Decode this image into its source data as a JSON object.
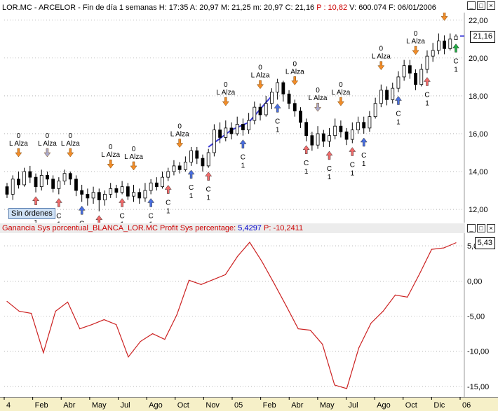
{
  "colors": {
    "background": "#ffffff",
    "header_bg": "#e8e8e8",
    "price_header_text": "#000000",
    "indicator_header_text": "#cc0000",
    "p_value_color": "#cc0000",
    "candle_up": "#ffffff",
    "candle_down": "#000000",
    "trend_line": "#3b3bd8",
    "equity_line": "#cc2222",
    "grid": "#888888",
    "arrow_short": "#f28c28",
    "arrow_long": "#f26a6a",
    "arrow_close_long": "#4a6fe0",
    "arrow_close_short": "#aaaacc",
    "arrow_green": "#22aa44",
    "axis_bg": "#f6f0c8",
    "order_box_bg": "#cfe1f5"
  },
  "price_panel": {
    "header": {
      "symbol": "LOR.MC - ARCELOR - Fin de día 1 semanas",
      "high": "H: 17:35",
      "open": "A: 20,97",
      "max": "M: 21,25",
      "min": "m: 20,97",
      "close": "C: 21,16",
      "p_value": "P : 10,82",
      "volume": "V: 600.074",
      "date": "F: 06/01/2006"
    },
    "last_value": "21,16",
    "order_label": "Sin órdenes",
    "window_buttons": [
      "_",
      "□",
      "×"
    ]
  },
  "indicator_panel": {
    "header": {
      "title": "Ganancia Sys porcentual_BLANCA_LOR.MC  Profit Sys percentage:",
      "value": "5,4297",
      "p_label": "P: -10,2411"
    },
    "last_value": "5,43",
    "window_buttons": [
      "_",
      "□",
      "×"
    ]
  },
  "x_axis": {
    "labels": [
      "4",
      "Feb",
      "Abr",
      "May",
      "Jul",
      "Ago",
      "Oct",
      "Nov",
      "05",
      "Feb",
      "Abr",
      "May",
      "Jul",
      "Ago",
      "Oct",
      "Dic",
      "06"
    ]
  },
  "signal_text": {
    "zero": "0",
    "short_label": "L Alza",
    "close_label": "C",
    "one": "1"
  },
  "chart_data": [
    {
      "type": "candlestick",
      "title": "",
      "ylim": [
        11.3,
        22.4
      ],
      "y_ticks": [
        "12,00",
        "14,00",
        "16,00",
        "18,00",
        "20,00",
        "22,00"
      ],
      "y_tick_values": [
        12,
        14,
        16,
        18,
        20,
        22
      ],
      "grid": true,
      "candles": [
        [
          13.2,
          12.8,
          13.4,
          12.6
        ],
        [
          12.8,
          13.6,
          13.8,
          12.5
        ],
        [
          13.6,
          13.3,
          14.0,
          13.1
        ],
        [
          13.3,
          14.0,
          14.2,
          13.2
        ],
        [
          14.0,
          13.7,
          14.3,
          13.4
        ],
        [
          13.7,
          13.2,
          13.9,
          12.9
        ],
        [
          13.2,
          13.8,
          14.1,
          13.0
        ],
        [
          13.8,
          13.6,
          14.0,
          13.3
        ],
        [
          13.6,
          13.1,
          13.8,
          12.9
        ],
        [
          13.1,
          13.5,
          13.7,
          12.8
        ],
        [
          13.5,
          13.9,
          14.1,
          13.3
        ],
        [
          13.9,
          13.6,
          14.0,
          13.3
        ],
        [
          13.6,
          13.0,
          13.8,
          12.7
        ],
        [
          13.0,
          12.8,
          13.3,
          12.4
        ],
        [
          12.8,
          12.6,
          13.1,
          12.2
        ],
        [
          12.6,
          12.9,
          13.2,
          12.3
        ],
        [
          12.9,
          12.5,
          13.1,
          11.9
        ],
        [
          12.5,
          12.8,
          13.0,
          12.2
        ],
        [
          12.8,
          13.1,
          13.4,
          12.6
        ],
        [
          13.1,
          12.9,
          13.3,
          12.6
        ],
        [
          12.9,
          13.2,
          13.5,
          12.8
        ],
        [
          13.2,
          12.7,
          13.4,
          12.5
        ],
        [
          12.7,
          12.9,
          13.3,
          12.4
        ],
        [
          12.9,
          12.6,
          13.1,
          12.3
        ],
        [
          12.6,
          13.0,
          13.4,
          12.4
        ],
        [
          13.0,
          13.4,
          13.6,
          12.8
        ],
        [
          13.4,
          13.2,
          13.7,
          13.0
        ],
        [
          13.2,
          13.7,
          14.0,
          13.1
        ],
        [
          13.7,
          14.0,
          14.2,
          13.5
        ],
        [
          14.0,
          14.3,
          14.6,
          13.8
        ],
        [
          14.3,
          14.1,
          14.5,
          13.9
        ],
        [
          14.1,
          14.5,
          14.8,
          14.0
        ],
        [
          14.5,
          15.1,
          15.3,
          14.3
        ],
        [
          15.1,
          14.7,
          15.3,
          14.4
        ],
        [
          14.7,
          14.3,
          14.9,
          14.0
        ],
        [
          14.3,
          15.0,
          15.2,
          14.2
        ],
        [
          15.0,
          16.2,
          16.5,
          14.8
        ],
        [
          16.2,
          15.8,
          16.6,
          15.5
        ],
        [
          15.8,
          16.3,
          16.7,
          15.6
        ],
        [
          16.3,
          16.0,
          16.6,
          15.7
        ],
        [
          16.0,
          16.5,
          16.9,
          15.9
        ],
        [
          16.5,
          16.2,
          16.8,
          15.9
        ],
        [
          16.2,
          16.7,
          17.1,
          16.0
        ],
        [
          16.7,
          17.4,
          17.7,
          16.5
        ],
        [
          17.4,
          17.0,
          17.6,
          16.7
        ],
        [
          17.0,
          17.6,
          18.0,
          16.9
        ],
        [
          17.6,
          18.2,
          18.4,
          17.3
        ],
        [
          18.2,
          18.7,
          18.9,
          17.8
        ],
        [
          18.7,
          18.1,
          18.8,
          17.7
        ],
        [
          18.1,
          17.6,
          18.3,
          17.3
        ],
        [
          17.6,
          17.2,
          17.8,
          16.9
        ],
        [
          17.2,
          16.6,
          17.4,
          16.3
        ],
        [
          16.6,
          15.9,
          16.8,
          15.6
        ],
        [
          15.9,
          15.4,
          16.1,
          15.1
        ],
        [
          15.4,
          16.0,
          16.4,
          15.2
        ],
        [
          16.0,
          15.6,
          16.2,
          15.3
        ],
        [
          15.6,
          15.9,
          16.3,
          15.3
        ],
        [
          15.9,
          16.4,
          16.8,
          15.7
        ],
        [
          16.4,
          16.1,
          16.7,
          15.8
        ],
        [
          16.1,
          15.7,
          16.3,
          15.4
        ],
        [
          15.7,
          16.2,
          16.6,
          15.5
        ],
        [
          16.2,
          16.6,
          16.9,
          16.0
        ],
        [
          16.6,
          16.3,
          16.9,
          16.0
        ],
        [
          16.3,
          16.9,
          17.2,
          16.1
        ],
        [
          16.9,
          17.6,
          17.9,
          16.8
        ],
        [
          17.6,
          18.3,
          18.6,
          17.4
        ],
        [
          18.3,
          17.8,
          18.5,
          17.5
        ],
        [
          17.8,
          18.4,
          18.7,
          17.6
        ],
        [
          18.4,
          19.0,
          19.3,
          18.2
        ],
        [
          19.0,
          19.6,
          19.9,
          18.8
        ],
        [
          19.6,
          19.2,
          19.9,
          18.9
        ],
        [
          19.2,
          18.6,
          19.4,
          18.3
        ],
        [
          18.6,
          19.4,
          19.7,
          18.5
        ],
        [
          19.4,
          20.1,
          20.4,
          19.2
        ],
        [
          20.1,
          20.4,
          20.8,
          19.8
        ],
        [
          20.4,
          20.9,
          21.3,
          20.2
        ],
        [
          20.9,
          20.5,
          21.2,
          20.2
        ],
        [
          20.5,
          21.0,
          21.3,
          20.4
        ],
        [
          20.97,
          21.16,
          21.25,
          20.97
        ]
      ],
      "trend_line": [
        [
          35,
          15.3
        ],
        [
          39,
          16.2
        ],
        [
          42,
          16.6
        ],
        [
          46,
          18.0
        ]
      ],
      "signals": [
        {
          "i": 2,
          "kind": "short"
        },
        {
          "i": 5,
          "kind": "long"
        },
        {
          "i": 7,
          "kind": "close_short"
        },
        {
          "i": 9,
          "kind": "long"
        },
        {
          "i": 11,
          "kind": "short"
        },
        {
          "i": 13,
          "kind": "close_long"
        },
        {
          "i": 16,
          "kind": "long"
        },
        {
          "i": 18,
          "kind": "short"
        },
        {
          "i": 20,
          "kind": "long"
        },
        {
          "i": 22,
          "kind": "short"
        },
        {
          "i": 25,
          "kind": "close_long"
        },
        {
          "i": 28,
          "kind": "long"
        },
        {
          "i": 30,
          "kind": "short"
        },
        {
          "i": 32,
          "kind": "close_long"
        },
        {
          "i": 35,
          "kind": "long"
        },
        {
          "i": 38,
          "kind": "short"
        },
        {
          "i": 41,
          "kind": "close_long"
        },
        {
          "i": 44,
          "kind": "short"
        },
        {
          "i": 47,
          "kind": "close_long"
        },
        {
          "i": 50,
          "kind": "short"
        },
        {
          "i": 52,
          "kind": "long"
        },
        {
          "i": 54,
          "kind": "close_short"
        },
        {
          "i": 56,
          "kind": "long"
        },
        {
          "i": 58,
          "kind": "short"
        },
        {
          "i": 60,
          "kind": "long"
        },
        {
          "i": 62,
          "kind": "close_long"
        },
        {
          "i": 65,
          "kind": "short"
        },
        {
          "i": 68,
          "kind": "close_long"
        },
        {
          "i": 71,
          "kind": "short"
        },
        {
          "i": 73,
          "kind": "long"
        },
        {
          "i": 76,
          "kind": "short"
        },
        {
          "i": 78,
          "kind": "green"
        }
      ]
    },
    {
      "type": "line",
      "title": "",
      "ylim": [
        -16.5,
        6.8
      ],
      "y_ticks": [
        "-15,00",
        "-10,00",
        "-5,00",
        "0,00",
        "5,00"
      ],
      "y_tick_values": [
        -15,
        -10,
        -5,
        0,
        5
      ],
      "grid": true,
      "series": [
        {
          "values": [
            -2.9,
            -4.3,
            -4.6,
            -10.2,
            -4.3,
            -3.0,
            -6.8,
            -6.2,
            -5.5,
            -6.2,
            -10.8,
            -8.6,
            -7.5,
            -8.3,
            -4.8,
            0.1,
            -0.5,
            0.2,
            0.9,
            3.5,
            5.5,
            2.8,
            -0.3,
            -3.5,
            -6.8,
            -7.0,
            -9.0,
            -14.8,
            -15.3,
            -9.5,
            -6.0,
            -4.3,
            -2.0,
            -2.3,
            1.0,
            4.5,
            4.7,
            5.43
          ]
        }
      ]
    }
  ]
}
